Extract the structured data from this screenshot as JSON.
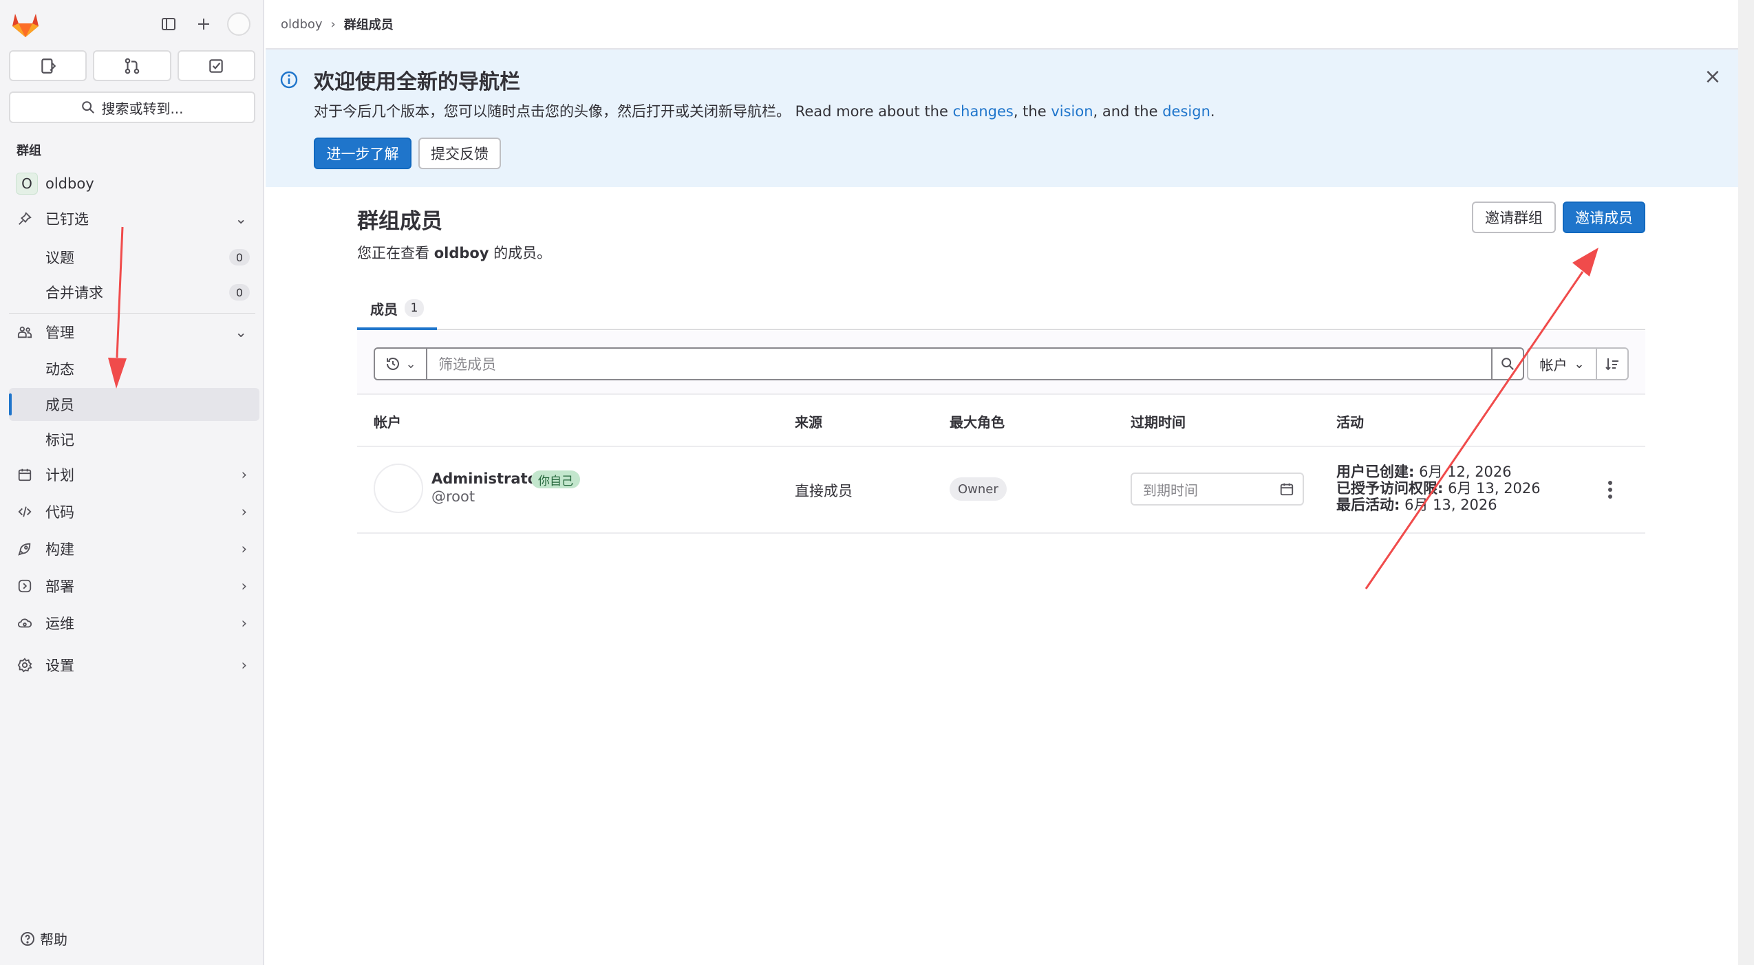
{
  "sidebar": {
    "search_label": "搜索或转到...",
    "section_title": "群组",
    "group": {
      "initial": "O",
      "name": "oldboy"
    },
    "pinned": {
      "label": "已钉选"
    },
    "pinned_items": [
      {
        "label": "议题",
        "count": "0"
      },
      {
        "label": "合并请求",
        "count": "0"
      }
    ],
    "manage": {
      "label": "管理"
    },
    "manage_items": [
      {
        "label": "动态"
      },
      {
        "label": "成员"
      },
      {
        "label": "标记"
      }
    ],
    "nav": [
      {
        "label": "计划"
      },
      {
        "label": "代码"
      },
      {
        "label": "构建"
      },
      {
        "label": "部署"
      },
      {
        "label": "运维"
      },
      {
        "label": "设置"
      }
    ],
    "help": "帮助"
  },
  "breadcrumb": {
    "parent": "oldboy",
    "sep": "›",
    "current": "群组成员"
  },
  "banner": {
    "title": "欢迎使用全新的导航栏",
    "text_prefix": "对于今后几个版本，您可以随时点击您的头像，然后打开或关闭新导航栏。 Read more about the ",
    "link_changes": "changes",
    "text_mid1": ", the ",
    "link_vision": "vision",
    "text_mid2": ", and the ",
    "link_design": "design",
    "text_end": ".",
    "learn_more": "进一步了解",
    "feedback": "提交反馈",
    "close": "×"
  },
  "page": {
    "title": "群组成员",
    "sub_prefix": "您正在查看 ",
    "sub_group": "oldboy",
    "sub_suffix": " 的成员。",
    "invite_group": "邀请群组",
    "invite_member": "邀请成员"
  },
  "tabs": [
    {
      "label": "成员",
      "count": "1"
    }
  ],
  "filter": {
    "placeholder": "筛选成员",
    "sort_label": "帐户"
  },
  "table": {
    "headers": [
      "帐户",
      "来源",
      "最大角色",
      "过期时间",
      "活动"
    ],
    "rows": [
      {
        "name": "Administrator",
        "badge": "你自己",
        "username": "@root",
        "source": "直接成员",
        "role": "Owner",
        "expiry_placeholder": "到期时间",
        "activity": [
          {
            "label": "用户已创建:",
            "value": " 6月 12, 2026"
          },
          {
            "label": "已授予访问权限:",
            "value": " 6月 13, 2026"
          },
          {
            "label": "最后活动:",
            "value": " 6月 13, 2026"
          }
        ]
      }
    ]
  },
  "colors": {
    "accent": "#1f75cb",
    "banner_bg": "#e9f3fc",
    "annotation": "#f04b4b"
  }
}
